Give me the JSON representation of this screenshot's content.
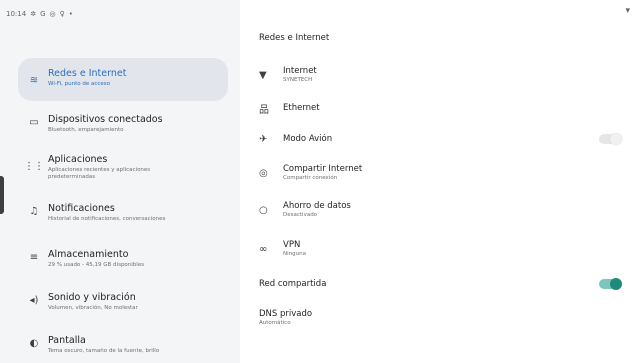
{
  "status_bar": {
    "time": "10:14",
    "right_icon": "wifi-icon"
  },
  "sidebar": {
    "items": [
      {
        "icon": "wifi-icon",
        "glyph": "≋",
        "title": "Redes e Internet",
        "subtitle": "Wi-Fi, punto de acceso",
        "active": true
      },
      {
        "icon": "devices-icon",
        "glyph": "▭",
        "title": "Dispositivos conectados",
        "subtitle": "Bluetooth, emparejamiento"
      },
      {
        "icon": "apps-icon",
        "glyph": "⋮⋮",
        "title": "Aplicaciones",
        "subtitle": "Aplicaciones recientes y aplicaciones predeterminadas"
      },
      {
        "icon": "bell-icon",
        "glyph": "♫",
        "title": "Notificaciones",
        "subtitle": "Historial de notificaciones, conversaciones"
      },
      {
        "icon": "storage-icon",
        "glyph": "≡",
        "title": "Almacenamiento",
        "subtitle": "29 % usado - 45,19 GB disponibles"
      },
      {
        "icon": "sound-icon",
        "glyph": "◂)",
        "title": "Sonido y vibración",
        "subtitle": "Volumen, vibración, No molestar"
      },
      {
        "icon": "display-icon",
        "glyph": "◐",
        "title": "Pantalla",
        "subtitle": "Tema oscuro, tamaño de la fuente, brillo"
      }
    ]
  },
  "main": {
    "title": "Redes e Internet",
    "rows": [
      {
        "icon": "wifi-icon",
        "glyph": "▼",
        "title": "Internet",
        "subtitle": "SYNETECH"
      },
      {
        "icon": "ethernet-icon",
        "glyph": "品",
        "title": "Ethernet",
        "subtitle": ""
      },
      {
        "icon": "airplane-icon",
        "glyph": "✈",
        "title": "Modo Avión",
        "subtitle": "",
        "toggle": "off"
      },
      {
        "icon": "hotspot-icon",
        "glyph": "◎",
        "title": "Compartir Internet",
        "subtitle": "Compartir conexión"
      },
      {
        "icon": "data-saver-icon",
        "glyph": "○",
        "title": "Ahorro de datos",
        "subtitle": "Desactivado"
      },
      {
        "icon": "vpn-icon",
        "glyph": "∞",
        "title": "VPN",
        "subtitle": "Ninguna"
      },
      {
        "icon": "",
        "glyph": "",
        "title": "Red compartida",
        "subtitle": "",
        "toggle": "on"
      },
      {
        "icon": "",
        "glyph": "",
        "title": "DNS privado",
        "subtitle": "Automático"
      }
    ]
  },
  "colors": {
    "accent": "#2b6fb8",
    "toggle_on": "#1e8a79",
    "sidebar_bg": "#f4f5f7",
    "active_bg": "#e2e6ec"
  }
}
